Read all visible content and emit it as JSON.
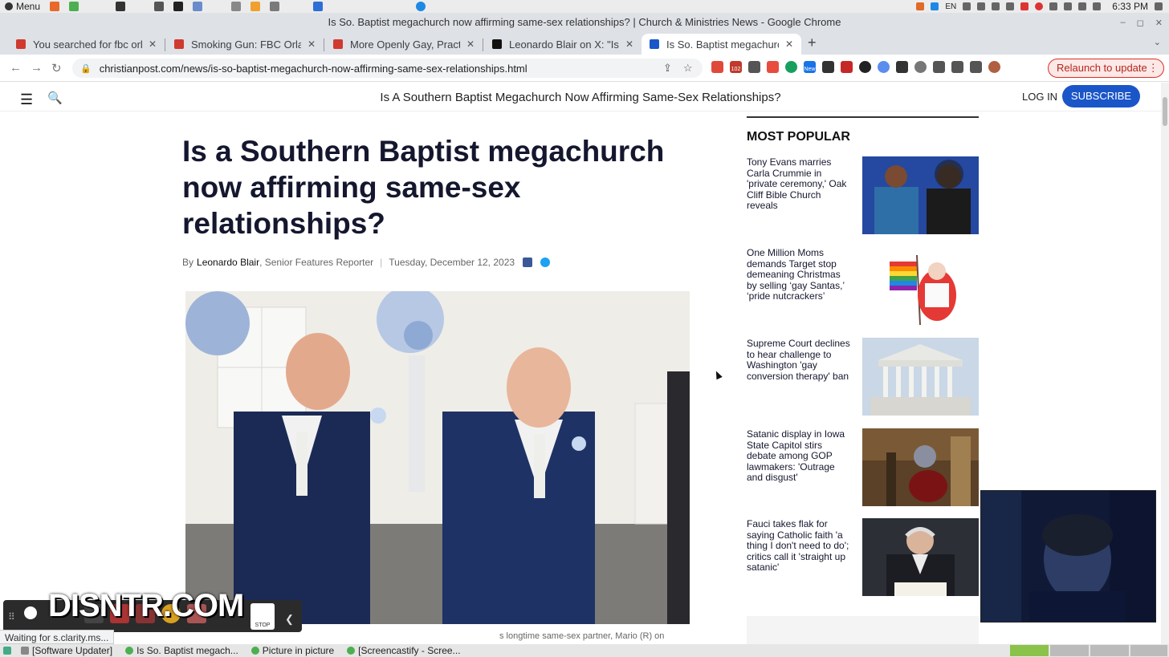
{
  "os": {
    "menu_label": "Menu",
    "clock": "6:33 PM",
    "lang": "EN"
  },
  "window": {
    "title": "Is So. Baptist megachurch now affirming same-sex relationships? | Church & Ministries News - Google Chrome"
  },
  "tabs": [
    {
      "label": "You searched for fbc orla",
      "favicon_color": "#d0392f"
    },
    {
      "label": "Smoking Gun: FBC Orlanc",
      "favicon_color": "#d0392f"
    },
    {
      "label": "More Openly Gay, Practic",
      "favicon_color": "#d0392f"
    },
    {
      "label": "Leonardo Blair on X: \"Is a",
      "favicon_color": "#111111"
    },
    {
      "label": "Is So. Baptist megachurcl",
      "favicon_color": "#1a56c8"
    }
  ],
  "toolbar": {
    "url": "christianpost.com/news/is-so-baptist-megachurch-now-affirming-same-sex-relationships.html",
    "relaunch_label": "Relaunch to update",
    "ext_badge_1": "102",
    "ext_badge_2": "New"
  },
  "site": {
    "header_title": "Is A Southern Baptist Megachurch Now Affirming Same-Sex Relationships?",
    "login_label": "LOG IN",
    "subscribe_label": "SUBSCRIBE",
    "accent": "#1a56c8"
  },
  "article": {
    "headline": "Is a Southern Baptist megachurch now affirming same-sex relationships?",
    "by": "By",
    "author": "Leonardo Blair",
    "role": ", Senior Features Reporter",
    "date": "Tuesday, December 12, 2023",
    "caption_fragment": "s longtime same-sex partner, Mario (R) on"
  },
  "most_popular": {
    "title": "MOST POPULAR",
    "items": [
      {
        "text": "Tony Evans marries Carla Crummie in 'private ceremony,' Oak Cliff Bible Church reveals"
      },
      {
        "text": "One Million Moms demands Target stop demeaning Christmas by selling ‘gay Santas,’ ‘pride nutcrackers’"
      },
      {
        "text": "Supreme Court declines to hear challenge to Washington 'gay conversion therapy' ban"
      },
      {
        "text": "Satanic display in Iowa State Capitol stirs debate among GOP lawmakers: 'Outrage and disgust'"
      },
      {
        "text": "Fauci takes flak for saying Catholic faith 'a thing I don't need to do'; critics call it 'straight up satanic'"
      }
    ]
  },
  "overlay": {
    "watermark": "DISNTR.COM",
    "stop_label": "STOP",
    "status_text": "Waiting for s.clarity.ms..."
  },
  "taskbar": {
    "items": [
      {
        "label": "[Software Updater]"
      },
      {
        "label": "Is So. Baptist megach..."
      },
      {
        "label": "Picture in picture"
      },
      {
        "label": "[Screencastify - Scree..."
      }
    ]
  }
}
